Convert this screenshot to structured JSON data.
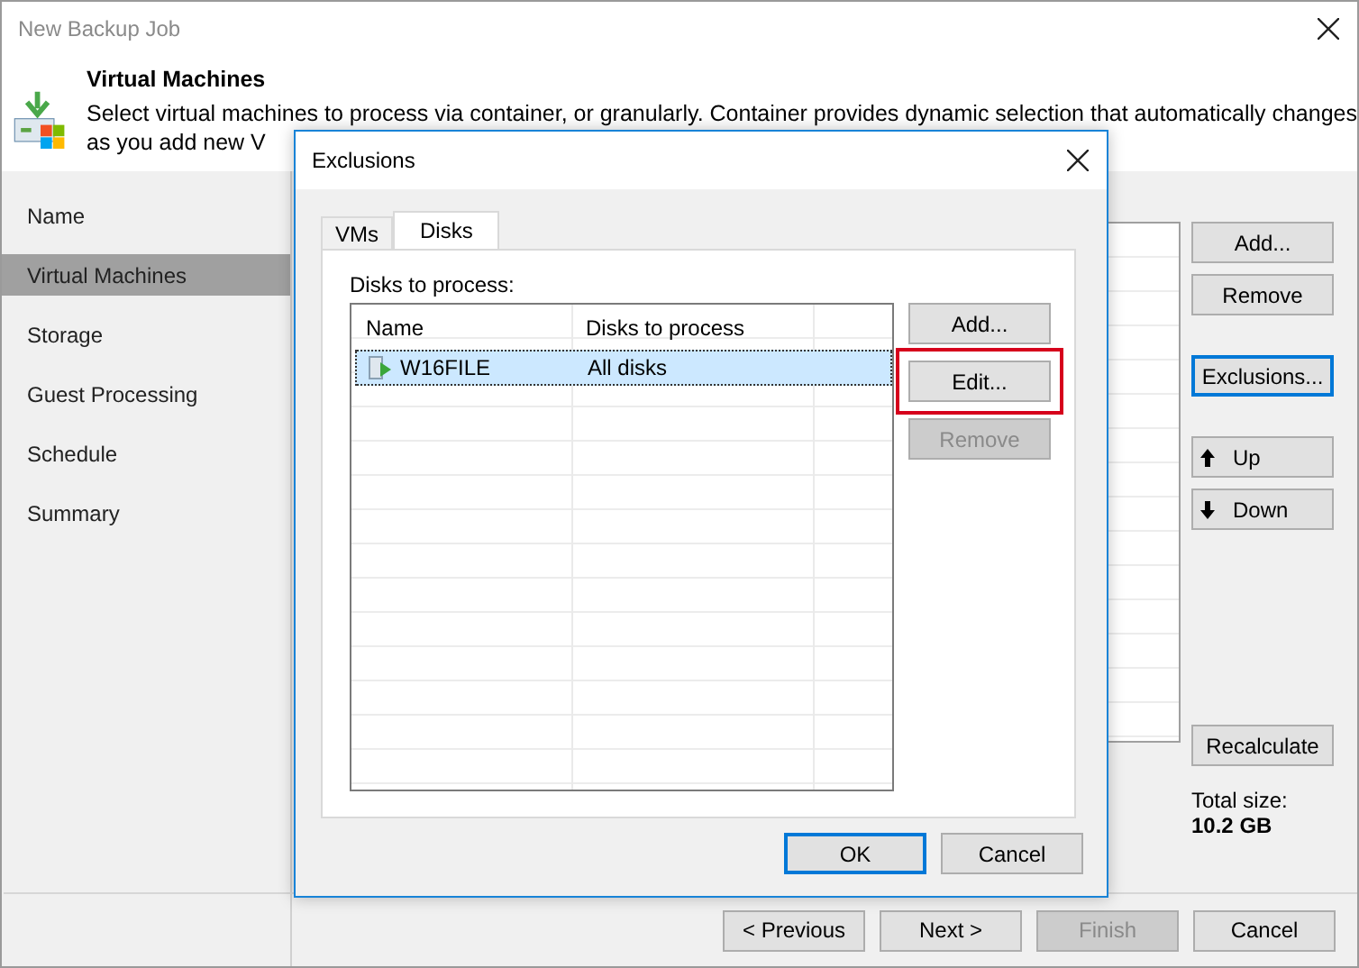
{
  "window": {
    "title": "New Backup Job"
  },
  "header": {
    "title": "Virtual Machines",
    "description_lines": [
      "Select virtual machines to process via container, or granularly. Container provides dynamic selection that automatically changes",
      "as you add new V"
    ]
  },
  "sidebar": {
    "items": [
      {
        "label": "Name",
        "selected": false
      },
      {
        "label": "Virtual Machines",
        "selected": true
      },
      {
        "label": "Storage",
        "selected": false
      },
      {
        "label": "Guest Processing",
        "selected": false
      },
      {
        "label": "Schedule",
        "selected": false
      },
      {
        "label": "Summary",
        "selected": false
      }
    ]
  },
  "side_button_groups": [
    [
      {
        "label": "Add...",
        "kind": "plain",
        "focused": false
      },
      {
        "label": "Remove",
        "kind": "plain",
        "focused": false
      }
    ],
    [
      {
        "label": "Exclusions...",
        "kind": "plain",
        "focused": true
      }
    ],
    [
      {
        "label": "Up",
        "kind": "up",
        "focused": false
      },
      {
        "label": "Down",
        "kind": "down",
        "focused": false
      }
    ]
  ],
  "recalculate_button": "Recalculate",
  "total_size": {
    "label": "Total size:",
    "value": "10.2 GB"
  },
  "footer_buttons": [
    {
      "label": "< Previous",
      "disabled": false
    },
    {
      "label": "Next >",
      "disabled": false
    },
    {
      "label": "Finish",
      "disabled": true
    },
    {
      "label": "Cancel",
      "disabled": false
    }
  ],
  "dialog": {
    "title": "Exclusions",
    "tabs": [
      {
        "label": "VMs",
        "selected": false
      },
      {
        "label": "Disks",
        "selected": true
      }
    ],
    "list_label": "Disks to process:",
    "columns": [
      "Name",
      "Disks to process"
    ],
    "rows": [
      {
        "name": "W16FILE",
        "disks": "All disks",
        "selected": true
      }
    ],
    "buttons": [
      {
        "label": "Add...",
        "disabled": false,
        "highlighted": false
      },
      {
        "label": "Edit...",
        "disabled": false,
        "highlighted": true
      },
      {
        "label": "Remove",
        "disabled": true,
        "highlighted": false
      }
    ],
    "footer_buttons": [
      {
        "label": "OK",
        "focused": true
      },
      {
        "label": "Cancel",
        "focused": false
      }
    ]
  }
}
